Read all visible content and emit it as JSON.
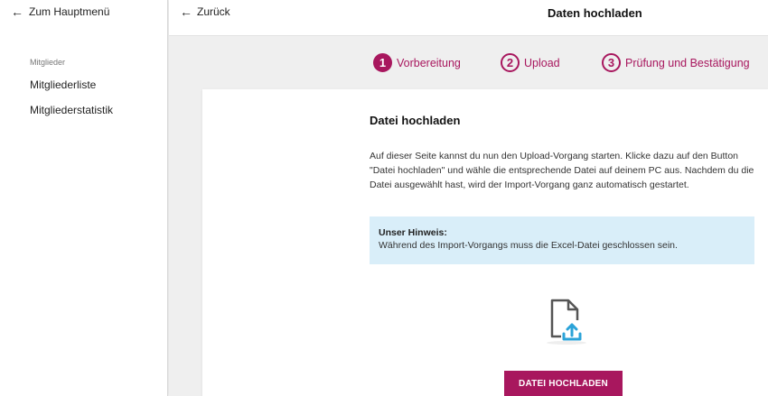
{
  "sidebar": {
    "back_label": "Zum Hauptmenü",
    "section": "Mitglieder",
    "items": [
      {
        "label": "Mitgliederliste"
      },
      {
        "label": "Mitgliederstatistik"
      }
    ]
  },
  "header": {
    "back_label": "Zurück",
    "title": "Daten hochladen"
  },
  "stepper": {
    "steps": [
      {
        "num": "1",
        "label": "Vorbereitung",
        "active": true
      },
      {
        "num": "2",
        "label": "Upload",
        "active": false
      },
      {
        "num": "3",
        "label": "Prüfung und Bestätigung",
        "active": false
      }
    ]
  },
  "card": {
    "title": "Datei hochladen",
    "text": "Auf dieser Seite kannst du nun den Upload-Vorgang starten. Klicke dazu auf den Button \"Datei hochladen\" und wähle die entsprechende Datei auf deinem PC aus. Nachdem du die Datei ausgewählt hast, wird der Import-Vorgang ganz automatisch gestartet.",
    "hint_title": "Unser Hinweis:",
    "hint_text": "Während des Import-Vorgangs muss die Excel-Datei geschlossen sein.",
    "upload_icon": "file-upload-icon",
    "button_label": "DATEI HOCHLADEN"
  },
  "colors": {
    "accent": "#a8175e",
    "hint_bg": "#d9eef9",
    "upload_arrow": "#2ba3d8"
  }
}
